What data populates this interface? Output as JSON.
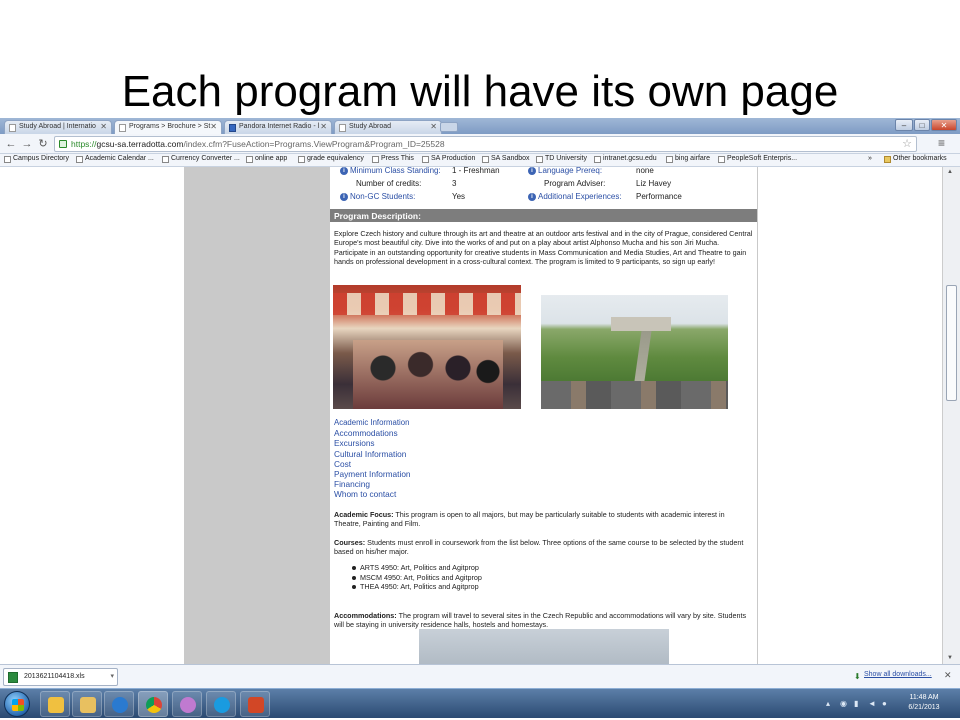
{
  "slide": {
    "title": "Each program will have its own page"
  },
  "browser": {
    "tabs": [
      {
        "label": "Study Abroad | Internatio",
        "active": false
      },
      {
        "label": "Programs > Brochure > St",
        "active": true
      },
      {
        "label": "Pandora Internet Radio - l",
        "active": false
      },
      {
        "label": "Study Abroad",
        "active": false
      }
    ],
    "url": {
      "secure": "https://",
      "host": "gcsu-sa.terradotta.com",
      "path": "/index.cfm?FuseAction=Programs.ViewProgram&Program_ID=25528"
    },
    "bookmarks": [
      "Campus Directory",
      "Academic Calendar ...",
      "Currency Converter ...",
      "online app",
      "grade equivalency",
      "Press This",
      "SA Production",
      "SA Sandbox",
      "TD University",
      "intranet.gcsu.edu",
      "bing airfare",
      "PeopleSoft Enterpris..."
    ],
    "other_bookmarks": "Other bookmarks",
    "overflow": "»"
  },
  "program": {
    "info_rows": [
      {
        "label": "Minimum Class Standing:",
        "value": "1 - Freshman",
        "label2": "Language Prereq:",
        "value2": "none"
      },
      {
        "label": "Number of credits:",
        "value": "3",
        "label2": "Program Adviser:",
        "value2": "Liz Havey"
      },
      {
        "label": "Non-GC Students:",
        "value": "Yes",
        "label2": "Additional Experiences:",
        "value2": "Performance"
      }
    ],
    "description_header": "Program Description:",
    "description": "Explore Czech history and culture through its art and theatre at an outdoor arts festival and in the city of Prague, considered Central Europe's most beautiful city. Dive into the works of and put on a play about artist Alphonso Mucha and his son Jiri Mucha. Participate in an outstanding opportunity for creative students in Mass Communication and Media Studies, Art and Theatre to gain hands on professional development in a cross-cultural context. The program is limited to 9 participants, so sign up early!",
    "quick_links": [
      "Academic Information",
      "Accommodations",
      "Excursions",
      "Cultural Information",
      "Cost",
      "Payment Information",
      "Financing",
      "Whom to contact"
    ],
    "academic_focus_label": "Academic Focus:",
    "academic_focus_text": " This program is open to all majors, but may be particularly suitable to students with academic interest in Theatre, Painting and Film.",
    "courses_label": "Courses:",
    "courses_text": " Students must enroll in coursework from the list below. Three options of the same course to be selected by the student based on his/her major.",
    "courses": [
      "ARTS 4950: Art, Politics and Agitprop",
      "MSCM 4950: Art, Politics and Agitprop",
      "THEA 4950: Art, Politics and Agitprop"
    ],
    "accommodations_label": "Accommodations:",
    "accommodations_text": " The program will travel to several sites in the Czech Republic and accommodations will vary by site. Students will be staying in university residence halls, hostels and homestays."
  },
  "downloads": {
    "file": "2013621104418.xls",
    "show_all": "Show all downloads..."
  },
  "taskbar": {
    "time": "11:48 AM",
    "date": "6/21/2013"
  }
}
